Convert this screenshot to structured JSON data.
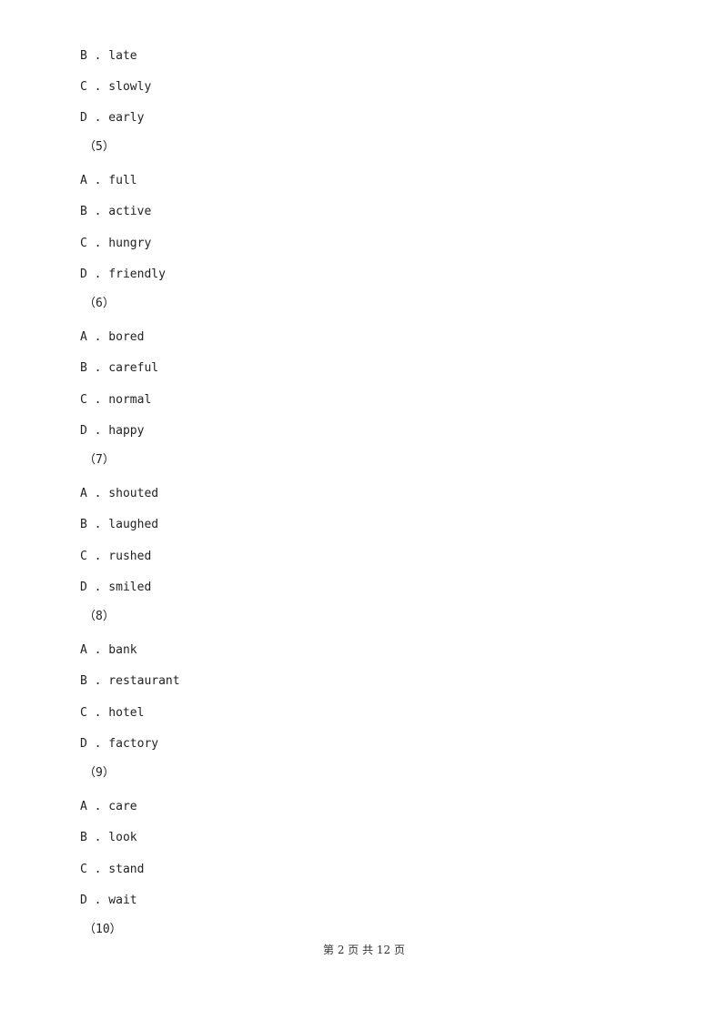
{
  "questions_partial": {
    "options": [
      {
        "letter": "B",
        "sep": " . ",
        "text": "late"
      },
      {
        "letter": "C",
        "sep": " . ",
        "text": "slowly"
      },
      {
        "letter": "D",
        "sep": " . ",
        "text": "early"
      }
    ]
  },
  "questions": [
    {
      "number": "（5）",
      "options": [
        {
          "label": "A . full"
        },
        {
          "label": "B . active"
        },
        {
          "label": "C . hungry"
        },
        {
          "label": "D . friendly"
        }
      ]
    },
    {
      "number": "（6）",
      "options": [
        {
          "label": "A . bored"
        },
        {
          "label": "B . careful"
        },
        {
          "label": "C . normal"
        },
        {
          "label": "D . happy"
        }
      ]
    },
    {
      "number": "（7）",
      "options": [
        {
          "label": "A . shouted"
        },
        {
          "label": "B . laughed"
        },
        {
          "label": "C . rushed"
        },
        {
          "label": "D . smiled"
        }
      ]
    },
    {
      "number": "（8）",
      "options": [
        {
          "label": "A . bank"
        },
        {
          "label": "B . restaurant"
        },
        {
          "label": "C . hotel"
        },
        {
          "label": "D . factory"
        }
      ]
    },
    {
      "number": "（9）",
      "options": [
        {
          "label": "A . care"
        },
        {
          "label": "B . look"
        },
        {
          "label": "C . stand"
        },
        {
          "label": "D . wait"
        }
      ]
    },
    {
      "number": "（10）",
      "options": []
    }
  ],
  "partial_labels": [
    "B . late",
    "C . slowly",
    "D . early"
  ],
  "footer": "第 2 页 共 12 页"
}
